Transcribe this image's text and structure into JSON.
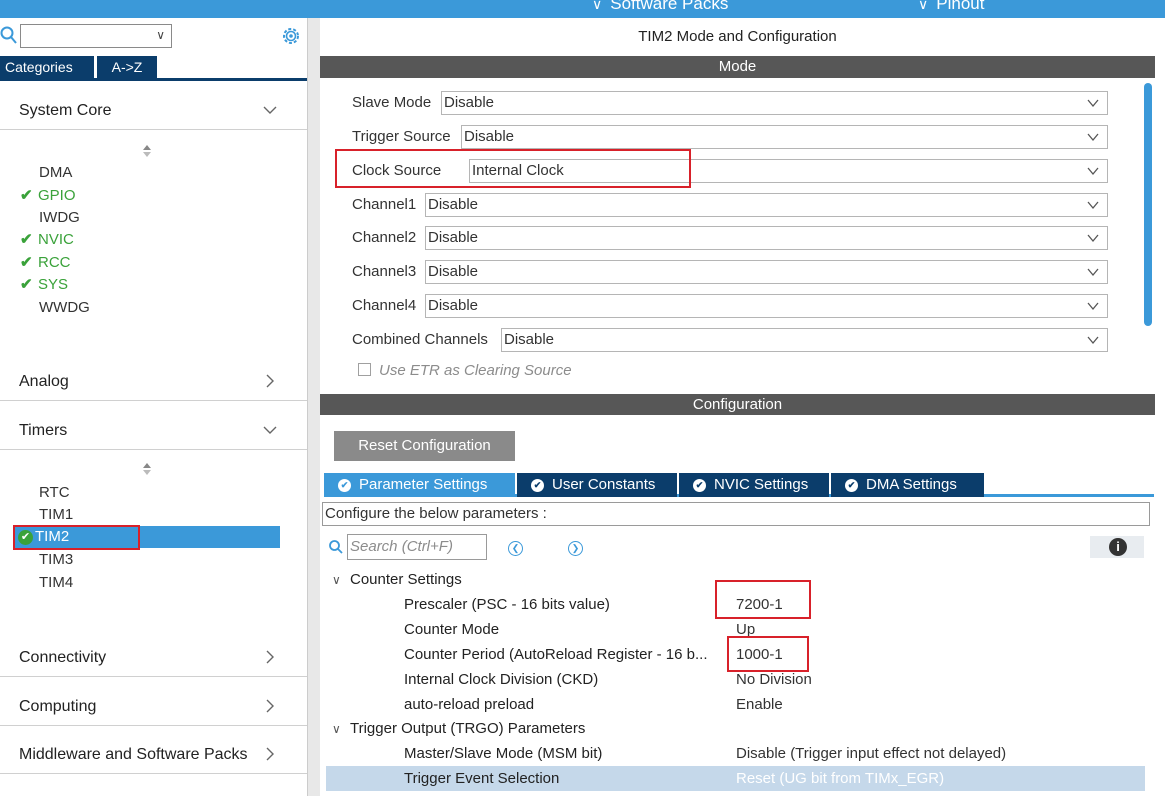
{
  "topbar": {
    "items": [
      {
        "label": "Software Packs"
      },
      {
        "label": "Pinout"
      }
    ]
  },
  "left": {
    "tabs": {
      "categories": "Categories",
      "az": "A->Z"
    },
    "sections": {
      "system_core": {
        "label": "System Core"
      },
      "analog": {
        "label": "Analog"
      },
      "timers": {
        "label": "Timers"
      },
      "connectivity": {
        "label": "Connectivity"
      },
      "computing": {
        "label": "Computing"
      },
      "middleware": {
        "label": "Middleware and Software Packs"
      }
    },
    "system_core_items": [
      "DMA",
      "GPIO",
      "IWDG",
      "NVIC",
      "RCC",
      "SYS",
      "WWDG"
    ],
    "timer_items": [
      "RTC",
      "TIM1",
      "TIM2",
      "TIM3",
      "TIM4"
    ],
    "colors": {
      "ok": "#3aa23a",
      "selected": "#3b99d9",
      "highlight_box": "#d8212a"
    }
  },
  "right": {
    "title": "TIM2 Mode and Configuration",
    "mode_band": "Mode",
    "config_band": "Configuration",
    "mode_rows": [
      {
        "label": "Slave Mode",
        "value": "Disable"
      },
      {
        "label": "Trigger Source",
        "value": "Disable"
      },
      {
        "label": "Clock Source",
        "value": "Internal Clock"
      },
      {
        "label": "Channel1",
        "value": "Disable"
      },
      {
        "label": "Channel2",
        "value": "Disable"
      },
      {
        "label": "Channel3",
        "value": "Disable"
      },
      {
        "label": "Channel4",
        "value": "Disable"
      },
      {
        "label": "Combined Channels",
        "value": "Disable"
      }
    ],
    "etr_label": "Use ETR as Clearing Source",
    "reset_label": "Reset Configuration",
    "tabs": [
      "Parameter Settings",
      "User Constants",
      "NVIC Settings",
      "DMA Settings"
    ],
    "hint": "Configure the below parameters :",
    "search_placeholder": "Search (Ctrl+F)",
    "groups": {
      "counter": "Counter Settings",
      "trgo": "Trigger Output (TRGO) Parameters"
    },
    "params": [
      {
        "name": "Prescaler (PSC - 16 bits value)",
        "value": "7200-1"
      },
      {
        "name": "Counter Mode",
        "value": "Up"
      },
      {
        "name": "Counter Period (AutoReload Register - 16 b...",
        "value": "1000-1"
      },
      {
        "name": "Internal Clock Division (CKD)",
        "value": "No Division"
      },
      {
        "name": "auto-reload preload",
        "value": "Enable"
      },
      {
        "name": "Master/Slave Mode (MSM bit)",
        "value": "Disable (Trigger input effect not delayed)"
      },
      {
        "name": "Trigger Event Selection",
        "value": "Reset (UG bit from TIMx_EGR)"
      }
    ]
  }
}
